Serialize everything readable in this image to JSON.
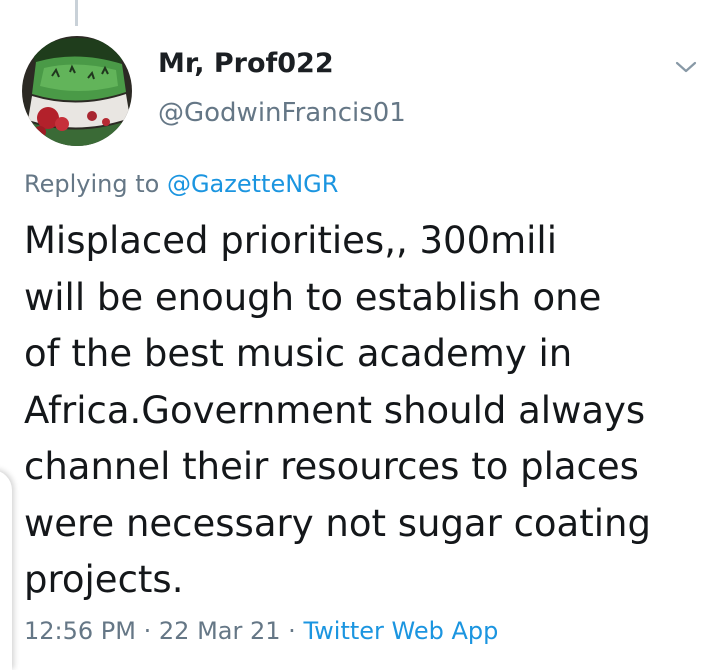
{
  "tweet": {
    "display_name": "Mr, Prof022",
    "handle": "@GodwinFrancis01",
    "replying_prefix": "Replying to",
    "replying_to": "@GazetteNGR",
    "text_lines": [
      "Misplaced priorities,, 300mili",
      "will be enough to establish one",
      "of the best music academy in",
      "Africa.Government should always",
      "channel their resources to places",
      "were necessary not sugar coating",
      "projects."
    ],
    "time": "12:56 PM",
    "date": "22 Mar 21",
    "separator": "·",
    "source": "Twitter Web App"
  },
  "icons": {
    "menu": "chevron-down-icon",
    "avatar": "avatar-image"
  },
  "colors": {
    "link": "#1b95e0",
    "secondary": "#657786",
    "text": "#14171a"
  }
}
